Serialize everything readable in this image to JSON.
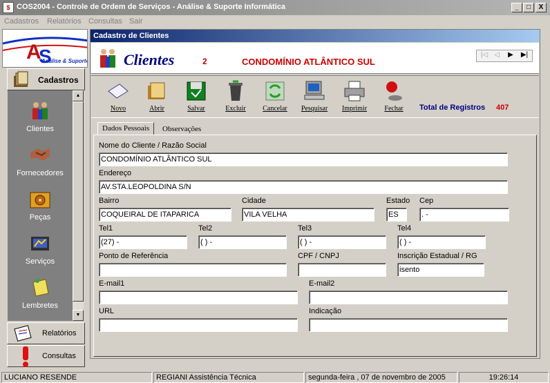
{
  "window": {
    "title": "COS2004 - Controle de Ordem de Serviços - Análise & Suporte Informática",
    "min": "_",
    "max": "□",
    "close": "X"
  },
  "menu": [
    "Cadastros",
    "Relatórios",
    "Consultas",
    "Sair"
  ],
  "logo": {
    "brand": "Análise & Suporte"
  },
  "sidebar": {
    "cadastros": "Cadastros",
    "items": [
      "Clientes",
      "Fornecedores",
      "Peças",
      "Serviços",
      "Lembretes"
    ],
    "relatorios": "Relatórios",
    "consultas": "Consultas"
  },
  "child": {
    "title": "Cadastro de Clientes",
    "header": {
      "heading": "Clientes",
      "record_number": "2",
      "record_name": "CONDOMÍNIO ATLÂNTICO SUL",
      "nav": [
        "|◁",
        "◁",
        "▶",
        "▶|"
      ]
    },
    "toolbar": {
      "buttons": [
        "Novo",
        "Abrir",
        "Salvar",
        "Excluir",
        "Cancelar",
        "Pesquisar",
        "Imprimir",
        "Fechar"
      ],
      "total_label": "Total de Registros",
      "total_value": "407"
    },
    "tabs": [
      "Dados Pessoais",
      "Observações"
    ],
    "form": {
      "nome_label": "Nome do Cliente / Razão Social",
      "nome": "CONDOMÍNIO ATLÂNTICO SUL",
      "endereco_label": "Endereço",
      "endereco": "AV.STA.LEOPOLDINA S/N",
      "bairro_label": "Bairro",
      "bairro": "COQUEIRAL DE ITAPARICA",
      "cidade_label": "Cidade",
      "cidade": "VILA VELHA",
      "estado_label": "Estado",
      "estado": "ES",
      "cep_label": "Cep",
      "cep": "  .   -",
      "tel1_label": "Tel1",
      "tel1": "(27)     -",
      "tel2_label": "Tel2",
      "tel2": "(  )     -",
      "tel3_label": "Tel3",
      "tel3": "(  )     -",
      "tel4_label": "Tel4",
      "tel4": "(  )     -",
      "ponto_label": "Ponto de Referência",
      "ponto": "",
      "cpf_label": "CPF / CNPJ",
      "cpf": "",
      "ie_label": "Inscrição Estadual / RG",
      "ie": "isento",
      "email1_label": "E-mail1",
      "email1": "",
      "email2_label": "E-mail2",
      "email2": "",
      "url_label": "URL",
      "url": "",
      "indicacao_label": "Indicação",
      "indicacao": ""
    }
  },
  "status": {
    "user": "LUCIANO RESENDE",
    "company": "REGIANI Assistência Técnica",
    "date": "segunda-feira , 07 de novembro de 2005",
    "time": "19:26:14"
  }
}
